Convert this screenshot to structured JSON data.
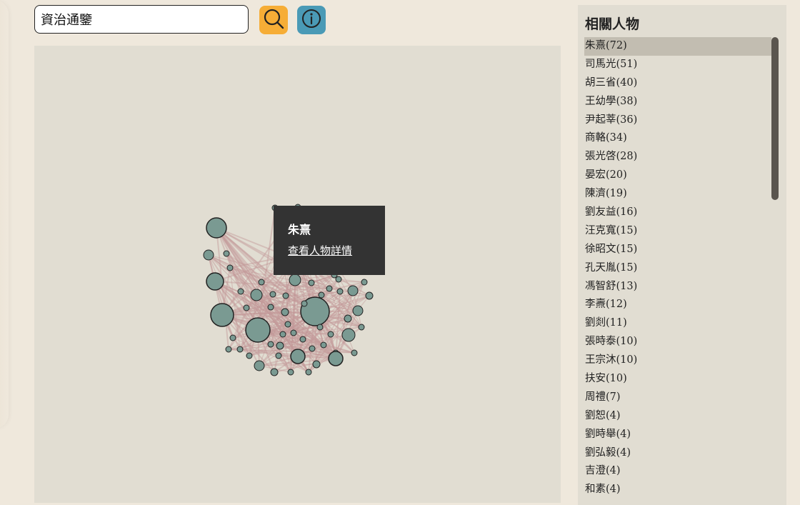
{
  "search": {
    "value": "資治通鑒",
    "search_icon": "magnifier-icon",
    "info_icon": "info-icon",
    "search_button_color": "#f6ad36",
    "info_button_color": "#4a9ab6"
  },
  "graph": {
    "background": "#e1ddd2",
    "node_color": "#7a9a92",
    "highlight_color": "#f6ad36",
    "edge_color": "#c49a9a"
  },
  "tooltip": {
    "name": "朱熹",
    "link": "查看人物詳情"
  },
  "sidebar": {
    "title": "相關人物",
    "selected_index": 0,
    "items": [
      "朱熹(72)",
      "司馬光(51)",
      "胡三省(40)",
      "王幼學(38)",
      "尹起莘(36)",
      "商輅(34)",
      "張光啓(28)",
      "晏宏(20)",
      "陳濟(19)",
      "劉友益(16)",
      "汪克寬(15)",
      "徐昭文(15)",
      "孔天胤(15)",
      "馮智舒(13)",
      "李燾(12)",
      "劉剡(11)",
      "張時泰(10)",
      "王宗沐(10)",
      "扶安(10)",
      "周禮(7)",
      "劉恕(4)",
      "劉時舉(4)",
      "劉弘毅(4)",
      "吉澄(4)",
      "和素(4)"
    ]
  }
}
